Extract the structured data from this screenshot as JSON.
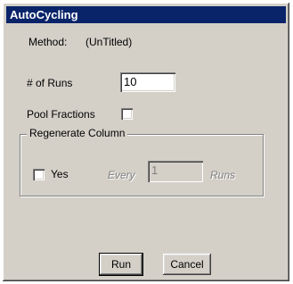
{
  "window": {
    "title": "AutoCycling"
  },
  "method": {
    "label": "Method:",
    "value": "(UnTitled)"
  },
  "runs": {
    "label": "# of Runs",
    "value": "10"
  },
  "pool_fractions": {
    "label": "Pool Fractions",
    "checked": false
  },
  "regenerate": {
    "group_label": "Regenerate Column",
    "yes_label": "Yes",
    "yes_checked": false,
    "every_label": "Every",
    "every_value": "1",
    "runs_label": "Runs"
  },
  "buttons": {
    "run": "Run",
    "cancel": "Cancel"
  }
}
